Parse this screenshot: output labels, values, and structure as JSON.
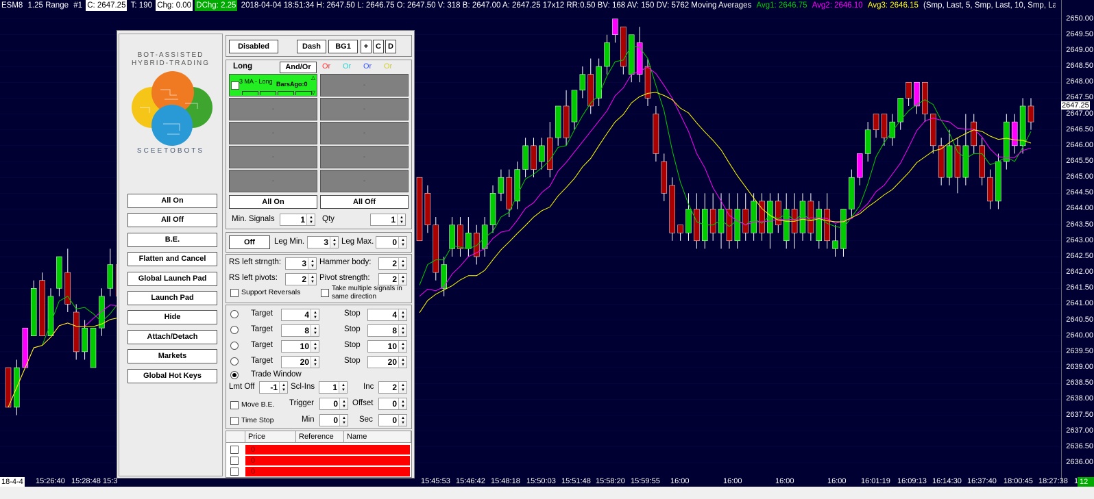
{
  "topbar": {
    "symbol": "ESM8",
    "range": "1.25 Range",
    "num": "#1",
    "close": "C: 2647.25",
    "ticks": "T: 190",
    "chg": "Chg: 0.00",
    "dchg": "DChg: 2.25",
    "rest": "2018-04-04 18:51:34 H: 2647.50 L: 2646.75 O: 2647.50 V: 318 B: 2647.00 A: 2647.25 17x12 RR:0.50 BV: 168 AV: 150 DV: 5762 Moving Averages",
    "avg1": "Avg1: 2646.75",
    "avg2": "Avg2: 2646.10",
    "avg3": "Avg3: 2646.15",
    "params": "(Smp, Last, 5, Smp, Last, 10, Smp, Last, 15)  3 MA -"
  },
  "colors": {
    "bg": "#000033",
    "up": "#00cc00",
    "down": "#aa0000",
    "highlight": "#ff00ff",
    "avg1": "#00cc00",
    "avg2": "#ff00ff",
    "avg3": "#ffff00"
  },
  "yaxis": {
    "ticks": [
      "2650.00",
      "2649.00",
      "2648.00",
      "2647.00",
      "2646.00",
      "2645.00",
      "2644.00",
      "2643.00",
      "2642.00",
      "2641.00",
      "2640.00",
      "2639.00",
      "2638.00",
      "2637.00",
      "2636.00"
    ],
    "half_ticks": [
      "2649.50",
      "2648.50",
      "2647.50",
      "2646.50",
      "2645.50",
      "2644.50",
      "2643.50",
      "2642.50",
      "2641.50",
      "2640.50",
      "2639.50",
      "2638.50",
      "2637.50",
      "2636.50"
    ],
    "last_price": "2647.25"
  },
  "xaxis": {
    "date": "18-4-4",
    "left_ticks": [
      "15:26:40",
      "15:28:48",
      "15:3"
    ],
    "right_ticks": [
      "15:45:53",
      "15:46:42",
      "15:48:18",
      "15:50:03",
      "15:51:48",
      "15:58:20",
      "15:59:55",
      "16:00",
      "16:00",
      "16:00",
      "16:00",
      "16:01:19",
      "16:09:13",
      "16:14:30",
      "16:37:40",
      "18:00:45",
      "18:27:38",
      "18:48:12"
    ],
    "corner": "12 E"
  },
  "chart_data": {
    "type": "candlestick",
    "x": [
      "c1",
      "c2",
      "c3",
      "c4",
      "c5",
      "c6",
      "c7",
      "c8",
      "c9",
      "c10",
      "c11",
      "c12",
      "c13",
      "c14",
      "c15",
      "c16",
      "c17",
      "c18",
      "c19",
      "c20",
      "c21",
      "c22",
      "c23",
      "c24",
      "c25",
      "c26",
      "c27",
      "c28",
      "c29",
      "c30",
      "c31",
      "c32",
      "c33",
      "c34",
      "c35",
      "c36",
      "c37",
      "c38",
      "c39",
      "c40",
      "c41",
      "c42",
      "c43",
      "c44",
      "c45",
      "c46",
      "c47",
      "c48",
      "c49",
      "c50",
      "c51",
      "c52",
      "c53",
      "c54",
      "c55",
      "c56",
      "c57",
      "c58",
      "c59",
      "c60",
      "c61",
      "c62",
      "c63",
      "c64",
      "c65",
      "c66",
      "c67",
      "c68",
      "c69",
      "c70",
      "c71",
      "c72",
      "c73",
      "c74",
      "c75",
      "c76",
      "c77",
      "c78",
      "c79",
      "c80",
      "c81",
      "c82",
      "c83",
      "c84",
      "c85",
      "c86",
      "c87",
      "c88",
      "c89",
      "c90",
      "c91",
      "c92",
      "c93",
      "c94",
      "c95",
      "c96",
      "c97",
      "c98",
      "c99",
      "c100",
      "c101",
      "c102",
      "c103",
      "c104",
      "c105",
      "c106",
      "c107",
      "c108",
      "c109",
      "c110",
      "c111",
      "c112",
      "c113",
      "c114",
      "c115",
      "c116",
      "c117",
      "c118",
      "c119",
      "c120",
      "c121",
      "c122",
      "c123",
      "c124"
    ],
    "candles": [
      [
        2639.0,
        2637.75,
        2639.0,
        2637.75,
        "d"
      ],
      [
        2637.75,
        2639.0,
        2639.25,
        2637.5,
        "u"
      ],
      [
        2639.0,
        2640.25,
        2640.25,
        2639.0,
        "h"
      ],
      [
        2640.0,
        2641.5,
        2641.75,
        2640.0,
        "u"
      ],
      [
        2641.75,
        2640.0,
        2642.0,
        2640.0,
        "d"
      ],
      [
        2640.0,
        2641.25,
        2641.5,
        2640.0,
        "u"
      ],
      [
        2641.5,
        2642.5,
        2642.5,
        2641.25,
        "u"
      ],
      [
        2642.0,
        2641.0,
        2642.75,
        2640.75,
        "d"
      ],
      [
        2640.75,
        2639.5,
        2641.0,
        2639.25,
        "d"
      ],
      [
        2639.5,
        2640.25,
        2640.5,
        2639.25,
        "u"
      ],
      [
        2639.0,
        2640.25,
        2640.25,
        2639.0,
        "u"
      ],
      [
        2640.25,
        2641.25,
        2641.5,
        2640.0,
        "u"
      ],
      [
        2641.5,
        2642.25,
        2642.75,
        2641.25,
        "u"
      ],
      [
        2642.25,
        2641.25,
        2642.5,
        2641.0,
        "d"
      ],
      [
        2645.0,
        2643.0,
        2645.0,
        2643.0,
        "d"
      ],
      [
        2644.5,
        2643.5,
        2644.75,
        2643.25,
        "d"
      ],
      [
        2643.5,
        2642.0,
        2643.75,
        2641.75,
        "d"
      ],
      [
        2641.5,
        2642.25,
        2642.5,
        2641.25,
        "u"
      ],
      [
        2642.75,
        2643.5,
        2643.75,
        2642.5,
        "u"
      ],
      [
        2643.5,
        2642.75,
        2643.75,
        2642.5,
        "d"
      ],
      [
        2642.75,
        2643.25,
        2643.75,
        2642.5,
        "u"
      ],
      [
        2643.25,
        2642.5,
        2643.5,
        2642.25,
        "d"
      ],
      [
        2642.75,
        2643.5,
        2643.75,
        2642.5,
        "u"
      ],
      [
        2643.5,
        2644.5,
        2644.75,
        2643.25,
        "u"
      ],
      [
        2644.5,
        2645.0,
        2645.25,
        2644.25,
        "u"
      ],
      [
        2645.0,
        2644.0,
        2645.25,
        2643.75,
        "d"
      ],
      [
        2644.25,
        2645.25,
        2645.5,
        2644.0,
        "u"
      ],
      [
        2645.25,
        2646.0,
        2646.25,
        2645.0,
        "u"
      ],
      [
        2646.0,
        2645.25,
        2646.25,
        2645.0,
        "d"
      ],
      [
        2645.5,
        2646.0,
        2646.25,
        2645.25,
        "u"
      ],
      [
        2646.25,
        2645.25,
        2646.75,
        2645.0,
        "d"
      ],
      [
        2646.25,
        2647.25,
        2647.25,
        2646.0,
        "u"
      ],
      [
        2647.25,
        2646.25,
        2647.75,
        2646.0,
        "d"
      ],
      [
        2646.75,
        2647.75,
        2647.75,
        2646.5,
        "u"
      ],
      [
        2647.75,
        2648.25,
        2648.5,
        2647.5,
        "u"
      ],
      [
        2648.25,
        2647.25,
        2648.75,
        2647.0,
        "d"
      ],
      [
        2647.5,
        2648.5,
        2648.75,
        2647.25,
        "u"
      ],
      [
        2648.5,
        2649.25,
        2649.5,
        2648.25,
        "u"
      ],
      [
        2649.5,
        2650.0,
        2650.0,
        2649.25,
        "h"
      ],
      [
        2649.75,
        2648.5,
        2649.75,
        2648.25,
        "d"
      ],
      [
        2648.25,
        2649.5,
        2649.5,
        2648.0,
        "u"
      ],
      [
        2649.25,
        2648.25,
        2649.75,
        2648.0,
        "h"
      ],
      [
        2648.5,
        2647.5,
        2648.75,
        2647.25,
        "d"
      ],
      [
        2647.0,
        2645.75,
        2647.25,
        2645.5,
        "d"
      ],
      [
        2645.5,
        2644.5,
        2645.75,
        2644.25,
        "d"
      ],
      [
        2644.75,
        2643.25,
        2645.0,
        2643.0,
        "d"
      ],
      [
        2643.5,
        2643.25,
        2643.5,
        2643.0,
        "d"
      ],
      [
        2643.25,
        2644.0,
        2644.5,
        2643.0,
        "u"
      ],
      [
        2644.0,
        2643.0,
        2644.5,
        2642.75,
        "d"
      ],
      [
        2643.0,
        2644.0,
        2644.5,
        2642.75,
        "u"
      ],
      [
        2644.0,
        2643.25,
        2644.5,
        2643.0,
        "d"
      ],
      [
        2643.25,
        2644.0,
        2644.5,
        2642.75,
        "u"
      ],
      [
        2644.0,
        2643.0,
        2644.5,
        2642.75,
        "d"
      ],
      [
        2643.0,
        2644.0,
        2644.5,
        2642.75,
        "u"
      ],
      [
        2644.0,
        2643.25,
        2644.5,
        2643.0,
        "d"
      ],
      [
        2643.25,
        2644.25,
        2644.5,
        2643.0,
        "u"
      ],
      [
        2644.25,
        2643.25,
        2644.5,
        2643.0,
        "d"
      ],
      [
        2643.25,
        2644.25,
        2644.5,
        2642.75,
        "u"
      ],
      [
        2644.25,
        2643.5,
        2644.5,
        2643.25,
        "d"
      ],
      [
        2643.0,
        2644.0,
        2644.5,
        2642.75,
        "u"
      ],
      [
        2644.0,
        2643.25,
        2644.5,
        2642.75,
        "d"
      ],
      [
        2643.25,
        2644.25,
        2644.5,
        2643.0,
        "u"
      ],
      [
        2644.25,
        2643.25,
        2644.5,
        2643.0,
        "d"
      ],
      [
        2643.0,
        2644.0,
        2644.25,
        2642.75,
        "u"
      ],
      [
        2644.0,
        2643.0,
        2644.5,
        2642.75,
        "d"
      ],
      [
        2643.0,
        2642.75,
        2643.5,
        2642.5,
        "u"
      ],
      [
        2642.75,
        2644.0,
        2644.0,
        2642.5,
        "u"
      ],
      [
        2644.0,
        2645.0,
        2645.25,
        2643.75,
        "u"
      ],
      [
        2645.0,
        2645.75,
        2645.75,
        2644.75,
        "h"
      ],
      [
        2645.75,
        2646.5,
        2646.75,
        2645.5,
        "u"
      ],
      [
        2646.5,
        2647.0,
        2647.0,
        2646.25,
        "d"
      ],
      [
        2647.0,
        2646.25,
        2647.0,
        2646.0,
        "d"
      ],
      [
        2646.25,
        2646.75,
        2647.0,
        2646.0,
        "u"
      ],
      [
        2646.75,
        2647.5,
        2647.5,
        2646.5,
        "u"
      ],
      [
        2647.5,
        2648.0,
        2648.0,
        2647.25,
        "d"
      ],
      [
        2647.25,
        2648.0,
        2648.0,
        2647.0,
        "h"
      ],
      [
        2648.0,
        2647.0,
        2648.0,
        2646.75,
        "d"
      ],
      [
        2647.0,
        2646.0,
        2647.0,
        2645.75,
        "d"
      ],
      [
        2646.0,
        2645.0,
        2646.25,
        2644.75,
        "d"
      ],
      [
        2645.0,
        2646.0,
        2646.5,
        2644.75,
        "u"
      ],
      [
        2646.0,
        2645.0,
        2646.25,
        2644.5,
        "d"
      ],
      [
        2645.0,
        2646.0,
        2647.0,
        2644.75,
        "u"
      ],
      [
        2646.0,
        2646.75,
        2647.0,
        2645.75,
        "d"
      ],
      [
        2646.0,
        2645.0,
        2646.25,
        2644.75,
        "d"
      ],
      [
        2645.0,
        2644.25,
        2645.25,
        2644.0,
        "d"
      ],
      [
        2644.25,
        2645.5,
        2645.75,
        2644.0,
        "u"
      ],
      [
        2645.5,
        2646.75,
        2647.0,
        2645.25,
        "u"
      ],
      [
        2646.75,
        2646.0,
        2647.0,
        2645.75,
        "h"
      ],
      [
        2646.0,
        2647.25,
        2647.5,
        2645.75,
        "u"
      ],
      [
        2647.25,
        2646.75,
        2647.5,
        2646.5,
        "d"
      ]
    ],
    "series": [
      {
        "name": "Avg1",
        "values": []
      },
      {
        "name": "Avg2",
        "values": []
      },
      {
        "name": "Avg3",
        "values": []
      }
    ],
    "ylim": [
      2636.0,
      2650.25
    ]
  },
  "panel": {
    "logo_line1": "BOT-ASSISTED",
    "logo_line2": "HYBRID-TRADING",
    "logo_brand": "SCEETOBOTS",
    "left_buttons": [
      "All On",
      "All Off",
      "B.E.",
      "Flatten and Cancel",
      "Global Launch Pad",
      "Launch Pad",
      "Hide",
      "Attach/Detach",
      "Markets",
      "Global Hot Keys"
    ],
    "top_buttons": {
      "disabled": "Disabled",
      "dash": "Dash",
      "bg1": "BG1",
      "plus": "+",
      "c": "C",
      "d": "D"
    },
    "long_label": "Long",
    "andor": "And/Or",
    "or_labels": [
      "Or",
      "Or",
      "Or",
      "Or"
    ],
    "or_colors": [
      "#ff3333",
      "#33cccc",
      "#3355ff",
      "#cccc33"
    ],
    "slot1": {
      "title": "3 MA - Long",
      "sub": "BarsAgo:0"
    },
    "empty_slot": "-",
    "all_on": "All On",
    "all_off": "All Off",
    "min_signals_label": "Min. Signals",
    "min_signals_value": "1",
    "qty_label": "Qty",
    "qty_value": "1",
    "off_btn": "Off",
    "leg_min_label": "Leg Min.",
    "leg_min_value": "3",
    "leg_max_label": "Leg Max.",
    "leg_max_value": "0",
    "rs_strength_label": "RS left strngth:",
    "rs_strength_value": "3",
    "hammer_label": "Hammer body:",
    "hammer_value": "2",
    "rs_pivots_label": "RS left pivots:",
    "rs_pivots_value": "2",
    "pivot_strength_label": "Pivot strength:",
    "pivot_strength_value": "2",
    "support_reversals": "Support Reversals",
    "take_multiple": "Take multiple signals in",
    "same_direction": "same direction",
    "targets": [
      {
        "label": "Target",
        "target": "4",
        "stop_label": "Stop",
        "stop": "4"
      },
      {
        "label": "Target",
        "target": "8",
        "stop_label": "Stop",
        "stop": "8"
      },
      {
        "label": "Target",
        "target": "10",
        "stop_label": "Stop",
        "stop": "10"
      },
      {
        "label": "Target",
        "target": "20",
        "stop_label": "Stop",
        "stop": "20"
      }
    ],
    "trade_window": "Trade Window",
    "lmt_off_label": "Lmt Off",
    "lmt_off_value": "-1",
    "scl_ins_label": "Scl-Ins",
    "scl_ins_value": "1",
    "inc_label": "Inc",
    "inc_value": "2",
    "move_be": "Move B.E.",
    "trigger_label": "Trigger",
    "trigger_value": "0",
    "offset_label": "Offset",
    "offset_value": "0",
    "time_stop": "Time Stop",
    "min_label": "Min",
    "min_value": "0",
    "sec_label": "Sec",
    "sec_value": "0",
    "table_headers": [
      "Price",
      "Reference",
      "Name"
    ],
    "table_rows": [
      "0",
      "0",
      "0"
    ]
  }
}
